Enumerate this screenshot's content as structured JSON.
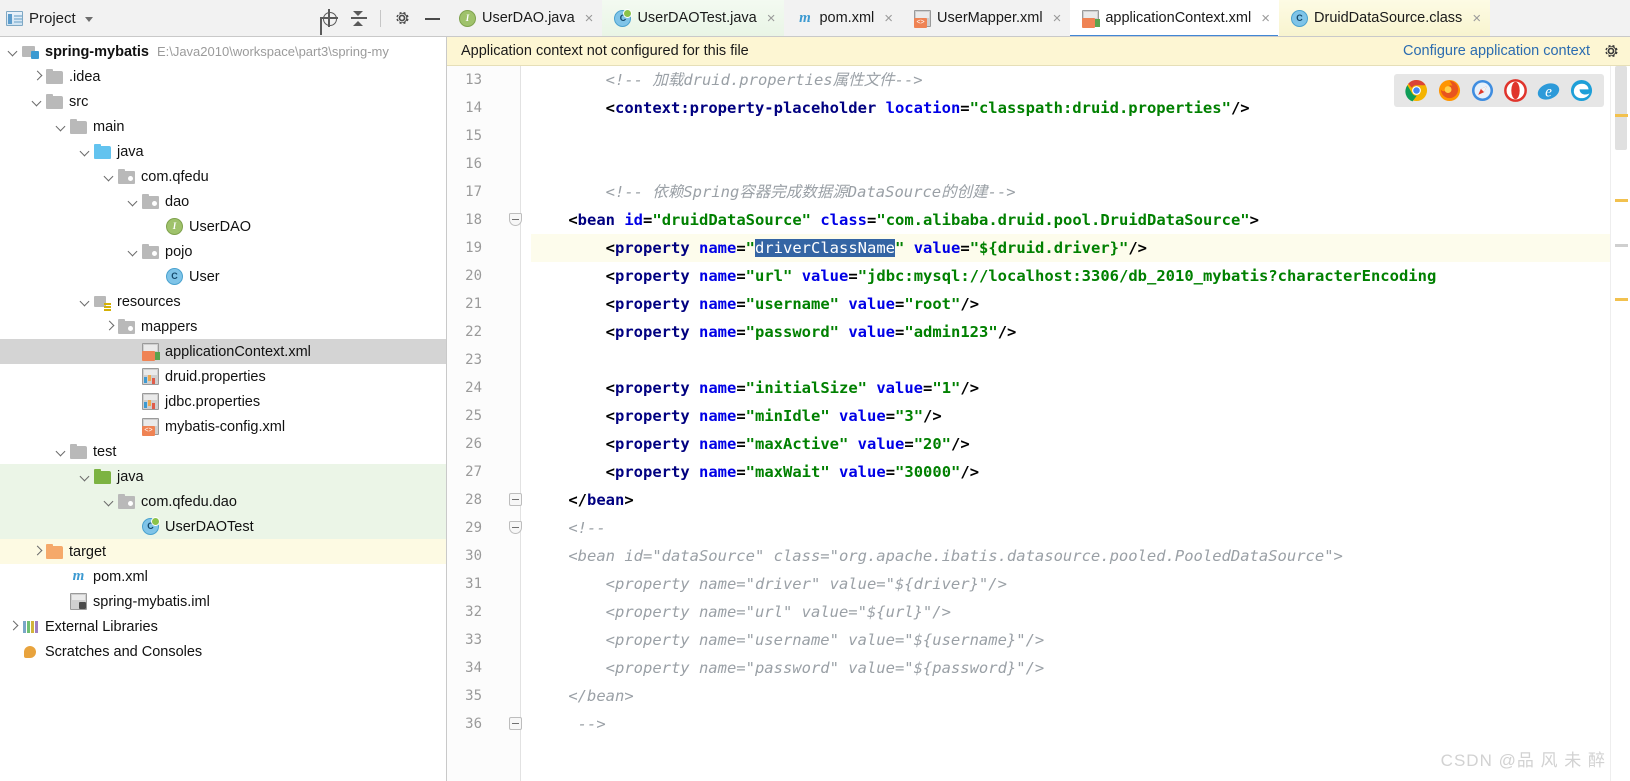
{
  "project_panel": {
    "title": "Project",
    "toolbar_icons": [
      "locate-icon",
      "collapse-all-icon",
      "gear-icon",
      "minimize-icon"
    ],
    "tree": [
      {
        "label": "spring-mybatis",
        "path": "E:\\Java2010\\workspace\\part3\\spring-my",
        "indent": 0,
        "arrow": "down",
        "icon": "module-icon",
        "bold": true,
        "state": "normal"
      },
      {
        "label": ".idea",
        "path": "",
        "indent": 1,
        "arrow": "right",
        "icon": "folder-icon",
        "bold": false,
        "state": "normal"
      },
      {
        "label": "src",
        "path": "",
        "indent": 1,
        "arrow": "down",
        "icon": "folder-icon",
        "bold": false,
        "state": "normal"
      },
      {
        "label": "main",
        "path": "",
        "indent": 2,
        "arrow": "down",
        "icon": "folder-icon",
        "bold": false,
        "state": "normal"
      },
      {
        "label": "java",
        "path": "",
        "indent": 3,
        "arrow": "down",
        "icon": "folder-blue-icon",
        "bold": false,
        "state": "normal"
      },
      {
        "label": "com.qfedu",
        "path": "",
        "indent": 4,
        "arrow": "down",
        "icon": "package-icon",
        "bold": false,
        "state": "normal"
      },
      {
        "label": "dao",
        "path": "",
        "indent": 5,
        "arrow": "down",
        "icon": "package-icon",
        "bold": false,
        "state": "normal"
      },
      {
        "label": "UserDAO",
        "path": "",
        "indent": 6,
        "arrow": "none",
        "icon": "interface-icon",
        "bold": false,
        "state": "normal"
      },
      {
        "label": "pojo",
        "path": "",
        "indent": 5,
        "arrow": "down",
        "icon": "package-icon",
        "bold": false,
        "state": "normal"
      },
      {
        "label": "User",
        "path": "",
        "indent": 6,
        "arrow": "none",
        "icon": "class-icon",
        "bold": false,
        "state": "normal"
      },
      {
        "label": "resources",
        "path": "",
        "indent": 3,
        "arrow": "down",
        "icon": "resources-folder-icon",
        "bold": false,
        "state": "normal"
      },
      {
        "label": "mappers",
        "path": "",
        "indent": 4,
        "arrow": "right",
        "icon": "package-icon",
        "bold": false,
        "state": "normal"
      },
      {
        "label": "applicationContext.xml",
        "path": "",
        "indent": 5,
        "arrow": "none",
        "icon": "spring-xml-icon",
        "bold": false,
        "state": "selected"
      },
      {
        "label": "druid.properties",
        "path": "",
        "indent": 5,
        "arrow": "none",
        "icon": "properties-icon",
        "bold": false,
        "state": "normal"
      },
      {
        "label": "jdbc.properties",
        "path": "",
        "indent": 5,
        "arrow": "none",
        "icon": "properties-icon",
        "bold": false,
        "state": "normal"
      },
      {
        "label": "mybatis-config.xml",
        "path": "",
        "indent": 5,
        "arrow": "none",
        "icon": "xml-icon",
        "bold": false,
        "state": "normal"
      },
      {
        "label": "test",
        "path": "",
        "indent": 2,
        "arrow": "down",
        "icon": "folder-icon",
        "bold": false,
        "state": "normal"
      },
      {
        "label": "java",
        "path": "",
        "indent": 3,
        "arrow": "down",
        "icon": "folder-green-icon",
        "bold": false,
        "state": "test"
      },
      {
        "label": "com.qfedu.dao",
        "path": "",
        "indent": 4,
        "arrow": "down",
        "icon": "package-icon",
        "bold": false,
        "state": "test"
      },
      {
        "label": "UserDAOTest",
        "path": "",
        "indent": 5,
        "arrow": "none",
        "icon": "test-class-icon",
        "bold": false,
        "state": "test"
      },
      {
        "label": "target",
        "path": "",
        "indent": 1,
        "arrow": "right",
        "icon": "folder-orange-icon",
        "bold": false,
        "state": "excluded"
      },
      {
        "label": "pom.xml",
        "path": "",
        "indent": 2,
        "arrow": "none",
        "icon": "maven-icon",
        "bold": false,
        "state": "normal"
      },
      {
        "label": "spring-mybatis.iml",
        "path": "",
        "indent": 2,
        "arrow": "none",
        "icon": "iml-icon",
        "bold": false,
        "state": "normal"
      },
      {
        "label": "External Libraries",
        "path": "",
        "indent": 0,
        "arrow": "right",
        "icon": "external-libraries-icon",
        "bold": false,
        "state": "normal"
      },
      {
        "label": "Scratches and Consoles",
        "path": "",
        "indent": 0,
        "arrow": "none",
        "icon": "scratches-icon",
        "bold": false,
        "state": "normal"
      }
    ]
  },
  "editor_tabs": [
    {
      "label": "UserDAO.java",
      "icon": "interface-icon",
      "active": false,
      "bg": "plain",
      "closable": true
    },
    {
      "label": "UserDAOTest.java",
      "icon": "test-class-icon",
      "active": false,
      "bg": "green",
      "closable": true
    },
    {
      "label": "pom.xml",
      "icon": "maven-icon",
      "active": false,
      "bg": "plain",
      "closable": true
    },
    {
      "label": "UserMapper.xml",
      "icon": "xml-icon",
      "active": false,
      "bg": "plain",
      "closable": true
    },
    {
      "label": "applicationContext.xml",
      "icon": "spring-xml-icon",
      "active": true,
      "bg": "plain",
      "closable": true
    },
    {
      "label": "DruidDataSource.class",
      "icon": "class-icon",
      "active": false,
      "bg": "yellow",
      "closable": true
    }
  ],
  "notification": {
    "message": "Application context not configured for this file",
    "link": "Configure application context",
    "gear": "gear-icon"
  },
  "browsers": [
    {
      "name": "chrome-icon",
      "color": "#4fae55"
    },
    {
      "name": "firefox-icon",
      "color": "#e8712a"
    },
    {
      "name": "safari-icon",
      "color": "#3f8de0"
    },
    {
      "name": "opera-icon",
      "color": "#e0342c"
    },
    {
      "name": "internet-explorer-icon",
      "color": "#2d9ad9"
    },
    {
      "name": "edge-icon",
      "color": "#1e9fd8"
    }
  ],
  "code": {
    "first_line_number": 13,
    "current_line": 19,
    "selected_token": "driverClassName",
    "lines": [
      {
        "n": 13,
        "fold": "none",
        "segs": [
          {
            "t": "cmt",
            "s": "        <!-- 加载druid.properties属性文件-->"
          }
        ]
      },
      {
        "n": 14,
        "fold": "none",
        "segs": [
          {
            "t": "punc",
            "s": "        <"
          },
          {
            "t": "tag",
            "s": "context:property-placeholder"
          },
          {
            "t": "plain",
            "s": " "
          },
          {
            "t": "attr",
            "s": "location"
          },
          {
            "t": "punc",
            "s": "="
          },
          {
            "t": "val",
            "s": "\"classpath:druid.properties\""
          },
          {
            "t": "punc",
            "s": "/>"
          }
        ]
      },
      {
        "n": 15,
        "fold": "none",
        "segs": [
          {
            "t": "plain",
            "s": ""
          }
        ]
      },
      {
        "n": 16,
        "fold": "none",
        "segs": [
          {
            "t": "plain",
            "s": ""
          }
        ]
      },
      {
        "n": 17,
        "fold": "none",
        "segs": [
          {
            "t": "cmt",
            "s": "        <!-- 依赖Spring容器完成数据源DataSource的创建-->"
          }
        ]
      },
      {
        "n": 18,
        "fold": "open",
        "segs": [
          {
            "t": "punc",
            "s": "    <"
          },
          {
            "t": "tag",
            "s": "bean"
          },
          {
            "t": "plain",
            "s": " "
          },
          {
            "t": "attr",
            "s": "id"
          },
          {
            "t": "punc",
            "s": "="
          },
          {
            "t": "val",
            "s": "\"druidDataSource\""
          },
          {
            "t": "plain",
            "s": " "
          },
          {
            "t": "attr",
            "s": "class"
          },
          {
            "t": "punc",
            "s": "="
          },
          {
            "t": "val",
            "s": "\"com.alibaba.druid.pool.DruidDataSource\""
          },
          {
            "t": "punc",
            "s": ">"
          }
        ]
      },
      {
        "n": 19,
        "fold": "none",
        "cur": true,
        "segs": [
          {
            "t": "punc",
            "s": "        <"
          },
          {
            "t": "tag",
            "s": "property"
          },
          {
            "t": "plain",
            "s": " "
          },
          {
            "t": "attr",
            "s": "name"
          },
          {
            "t": "punc",
            "s": "="
          },
          {
            "t": "val",
            "s": "\""
          },
          {
            "t": "sel",
            "s": "driverClassName"
          },
          {
            "t": "val",
            "s": "\""
          },
          {
            "t": "plain",
            "s": " "
          },
          {
            "t": "attr",
            "s": "value"
          },
          {
            "t": "punc",
            "s": "="
          },
          {
            "t": "val",
            "s": "\"${druid.driver}\""
          },
          {
            "t": "punc",
            "s": "/>"
          }
        ]
      },
      {
        "n": 20,
        "fold": "none",
        "segs": [
          {
            "t": "punc",
            "s": "        <"
          },
          {
            "t": "tag",
            "s": "property"
          },
          {
            "t": "plain",
            "s": " "
          },
          {
            "t": "attr",
            "s": "name"
          },
          {
            "t": "punc",
            "s": "="
          },
          {
            "t": "val",
            "s": "\"url\""
          },
          {
            "t": "plain",
            "s": " "
          },
          {
            "t": "attr",
            "s": "value"
          },
          {
            "t": "punc",
            "s": "="
          },
          {
            "t": "val",
            "s": "\"jdbc:mysql://localhost:3306/db_2010_mybatis?characterEncoding"
          }
        ]
      },
      {
        "n": 21,
        "fold": "none",
        "segs": [
          {
            "t": "punc",
            "s": "        <"
          },
          {
            "t": "tag",
            "s": "property"
          },
          {
            "t": "plain",
            "s": " "
          },
          {
            "t": "attr",
            "s": "name"
          },
          {
            "t": "punc",
            "s": "="
          },
          {
            "t": "val",
            "s": "\"username\""
          },
          {
            "t": "plain",
            "s": " "
          },
          {
            "t": "attr",
            "s": "value"
          },
          {
            "t": "punc",
            "s": "="
          },
          {
            "t": "val",
            "s": "\"root\""
          },
          {
            "t": "punc",
            "s": "/>"
          }
        ]
      },
      {
        "n": 22,
        "fold": "none",
        "segs": [
          {
            "t": "punc",
            "s": "        <"
          },
          {
            "t": "tag",
            "s": "property"
          },
          {
            "t": "plain",
            "s": " "
          },
          {
            "t": "attr",
            "s": "name"
          },
          {
            "t": "punc",
            "s": "="
          },
          {
            "t": "val",
            "s": "\"password\""
          },
          {
            "t": "plain",
            "s": " "
          },
          {
            "t": "attr",
            "s": "value"
          },
          {
            "t": "punc",
            "s": "="
          },
          {
            "t": "val",
            "s": "\"admin123\""
          },
          {
            "t": "punc",
            "s": "/>"
          }
        ]
      },
      {
        "n": 23,
        "fold": "none",
        "segs": [
          {
            "t": "plain",
            "s": ""
          }
        ]
      },
      {
        "n": 24,
        "fold": "none",
        "segs": [
          {
            "t": "punc",
            "s": "        <"
          },
          {
            "t": "tag",
            "s": "property"
          },
          {
            "t": "plain",
            "s": " "
          },
          {
            "t": "attr",
            "s": "name"
          },
          {
            "t": "punc",
            "s": "="
          },
          {
            "t": "val",
            "s": "\"initialSize\""
          },
          {
            "t": "plain",
            "s": " "
          },
          {
            "t": "attr",
            "s": "value"
          },
          {
            "t": "punc",
            "s": "="
          },
          {
            "t": "val",
            "s": "\"1\""
          },
          {
            "t": "punc",
            "s": "/>"
          }
        ]
      },
      {
        "n": 25,
        "fold": "none",
        "segs": [
          {
            "t": "punc",
            "s": "        <"
          },
          {
            "t": "tag",
            "s": "property"
          },
          {
            "t": "plain",
            "s": " "
          },
          {
            "t": "attr",
            "s": "name"
          },
          {
            "t": "punc",
            "s": "="
          },
          {
            "t": "val",
            "s": "\"minIdle\""
          },
          {
            "t": "plain",
            "s": " "
          },
          {
            "t": "attr",
            "s": "value"
          },
          {
            "t": "punc",
            "s": "="
          },
          {
            "t": "val",
            "s": "\"3\""
          },
          {
            "t": "punc",
            "s": "/>"
          }
        ]
      },
      {
        "n": 26,
        "fold": "none",
        "segs": [
          {
            "t": "punc",
            "s": "        <"
          },
          {
            "t": "tag",
            "s": "property"
          },
          {
            "t": "plain",
            "s": " "
          },
          {
            "t": "attr",
            "s": "name"
          },
          {
            "t": "punc",
            "s": "="
          },
          {
            "t": "val",
            "s": "\"maxActive\""
          },
          {
            "t": "plain",
            "s": " "
          },
          {
            "t": "attr",
            "s": "value"
          },
          {
            "t": "punc",
            "s": "="
          },
          {
            "t": "val",
            "s": "\"20\""
          },
          {
            "t": "punc",
            "s": "/>"
          }
        ]
      },
      {
        "n": 27,
        "fold": "none",
        "segs": [
          {
            "t": "punc",
            "s": "        <"
          },
          {
            "t": "tag",
            "s": "property"
          },
          {
            "t": "plain",
            "s": " "
          },
          {
            "t": "attr",
            "s": "name"
          },
          {
            "t": "punc",
            "s": "="
          },
          {
            "t": "val",
            "s": "\"maxWait\""
          },
          {
            "t": "plain",
            "s": " "
          },
          {
            "t": "attr",
            "s": "value"
          },
          {
            "t": "punc",
            "s": "="
          },
          {
            "t": "val",
            "s": "\"30000\""
          },
          {
            "t": "punc",
            "s": "/>"
          }
        ]
      },
      {
        "n": 28,
        "fold": "close",
        "segs": [
          {
            "t": "punc",
            "s": "    </"
          },
          {
            "t": "tag",
            "s": "bean"
          },
          {
            "t": "punc",
            "s": ">"
          }
        ]
      },
      {
        "n": 29,
        "fold": "open",
        "segs": [
          {
            "t": "cmt",
            "s": "    <!--"
          }
        ]
      },
      {
        "n": 30,
        "fold": "none",
        "segs": [
          {
            "t": "cmt",
            "s": "    <bean id=\"dataSource\" class=\"org.apache.ibatis.datasource.pooled.PooledDataSource\">"
          }
        ]
      },
      {
        "n": 31,
        "fold": "none",
        "segs": [
          {
            "t": "cmt",
            "s": "        <property name=\"driver\" value=\"${driver}\"/>"
          }
        ]
      },
      {
        "n": 32,
        "fold": "none",
        "segs": [
          {
            "t": "cmt",
            "s": "        <property name=\"url\" value=\"${url}\"/>"
          }
        ]
      },
      {
        "n": 33,
        "fold": "none",
        "segs": [
          {
            "t": "cmt",
            "s": "        <property name=\"username\" value=\"${username}\"/>"
          }
        ]
      },
      {
        "n": 34,
        "fold": "none",
        "segs": [
          {
            "t": "cmt",
            "s": "        <property name=\"password\" value=\"${password}\"/>"
          }
        ]
      },
      {
        "n": 35,
        "fold": "none",
        "segs": [
          {
            "t": "cmt",
            "s": "    </bean>"
          }
        ]
      },
      {
        "n": 36,
        "fold": "close",
        "segs": [
          {
            "t": "cmt",
            "s": "     -->"
          }
        ]
      }
    ]
  },
  "watermark": "CSDN @品 风 未 醉"
}
